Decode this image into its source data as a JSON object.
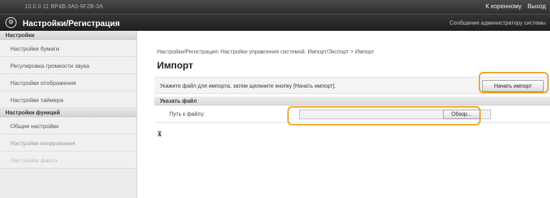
{
  "topbar": {
    "host": "10.0.0.11   BP4B-3A0-9F2B-3A",
    "user_label": "К коренному",
    "logout_label": "Выход"
  },
  "header": {
    "logo_icon": "gear-icon",
    "title": "Настройки/Регистрация",
    "admin_message": "Сообщение администратору системы"
  },
  "sidebar": {
    "sections": [
      {
        "heading": "Настройки",
        "items": [
          "Настройки бумаги",
          "Регулировка громкости звука",
          "Настройки отображения",
          "Настройки таймера"
        ]
      },
      {
        "heading": "Настройки функций",
        "items": [
          "Общие настройки",
          "Настройки копирования",
          "Настройки факса"
        ]
      }
    ]
  },
  "main": {
    "breadcrumb": "Настройки/Регистрация: Настройки управления системой: Импорт/Экспорт > Импорт",
    "title": "Импорт",
    "instruction": "Укажите файл для импорта, затем щелкните кнопку [Начать импорт].",
    "start_import_label": "Начать импорт",
    "specify_file_heading": "Указать файл",
    "file_path_label": "Путь к файлу:",
    "browse_label": "Обзор...",
    "collapse_icon": "collapse-up-icon"
  },
  "colors": {
    "highlight": "#f0a020",
    "header_bg": "#2a2a2a",
    "sidebar_bg": "#ececec"
  }
}
